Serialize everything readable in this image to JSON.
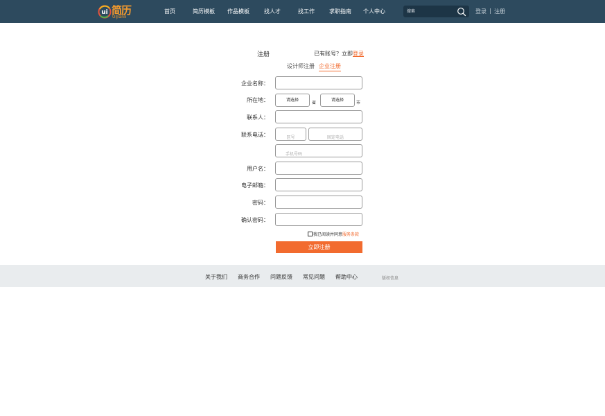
{
  "header": {
    "logo": {
      "cn": "简历",
      "en": "UIJianli"
    },
    "nav": [
      {
        "label": "首页"
      },
      {
        "label": "简历模板"
      },
      {
        "label": "作品模板"
      },
      {
        "label": "找人才"
      },
      {
        "label": "找工作"
      },
      {
        "label": "求职指南"
      },
      {
        "label": "个人中心"
      }
    ],
    "search": {
      "placeholder": "搜索",
      "icon": "search-icon"
    },
    "login": "登录",
    "separator": "|",
    "register": "注册"
  },
  "form": {
    "title": "注册",
    "have_account": "已有账号？立即",
    "login_link": "登录",
    "tabs": {
      "designer": "设计师注册",
      "company": "企业注册",
      "active": "企业注册"
    },
    "labels": {
      "company_name": "企业名称：",
      "location": "所在地：",
      "contact": "联系人：",
      "phone": "联系电话：",
      "username": "用户名：",
      "email": "电子邮箱：",
      "password": "密码：",
      "confirm_password": "确认密码："
    },
    "province_select": "请选择",
    "province_unit": "省",
    "city_select": "请选择",
    "city_unit": "市",
    "area_code_placeholder": "区号",
    "landline_placeholder": "固定电话",
    "mobile_placeholder": "手机号码",
    "agree_text": "我已阅读并同意",
    "terms_link": "服务条款",
    "submit": "立即注册"
  },
  "footer": {
    "links": [
      {
        "label": "关于我们"
      },
      {
        "label": "商务合作"
      },
      {
        "label": "问题反馈"
      },
      {
        "label": "常见问题"
      },
      {
        "label": "帮助中心"
      }
    ],
    "copyright": "版权信息"
  },
  "colors": {
    "header_bg": "#2d4a5e",
    "accent": "#f26b2f",
    "footer_bg": "#e9ecee",
    "logo": "#f29a2e"
  }
}
